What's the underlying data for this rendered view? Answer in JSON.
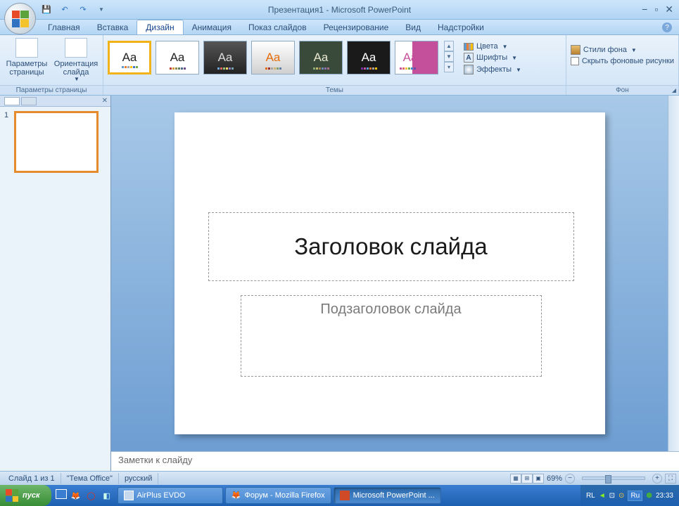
{
  "titlebar": {
    "title": "Презентация1 - Microsoft PowerPoint"
  },
  "tabs": {
    "home": "Главная",
    "insert": "Вставка",
    "design": "Дизайн",
    "animation": "Анимация",
    "slideshow": "Показ слайдов",
    "review": "Рецензирование",
    "view": "Вид",
    "addins": "Надстройки"
  },
  "ribbon": {
    "group_page": {
      "label": "Параметры страницы",
      "btn_page": "Параметры страницы",
      "btn_orient": "Ориентация слайда"
    },
    "group_themes": {
      "label": "Темы",
      "colors": "Цвета",
      "fonts": "Шрифты",
      "effects": "Эффекты"
    },
    "group_bg": {
      "label": "Фон",
      "styles": "Стили фона",
      "hide": "Скрыть фоновые рисунки"
    }
  },
  "slide": {
    "thumb_num": "1",
    "title": "Заголовок слайда",
    "subtitle": "Подзаголовок слайда"
  },
  "notes": {
    "placeholder": "Заметки к слайду"
  },
  "status": {
    "slide": "Слайд 1 из 1",
    "theme": "\"Тема Office\"",
    "lang": "русский",
    "zoom": "69%"
  },
  "taskbar": {
    "start": "пуск",
    "task1": "AirPlus EVDO",
    "task2": "Форум - Mozilla Firefox",
    "task3": "Microsoft PowerPoint ...",
    "lang_ind": "RL",
    "lang_ind2": "Ru",
    "clock": "23:33"
  }
}
